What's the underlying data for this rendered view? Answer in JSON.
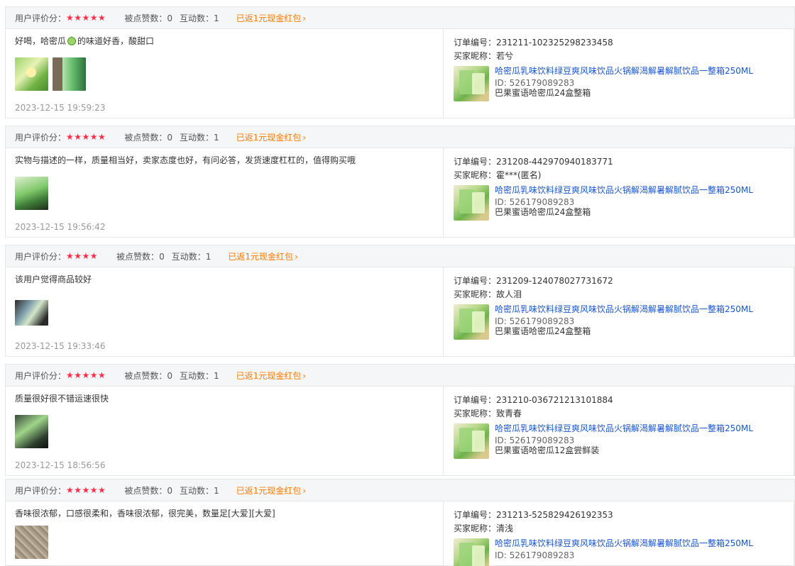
{
  "labels": {
    "rating": "用户评价分：",
    "likes": "被点赞数：",
    "interactions": "互动数：",
    "bonus": "已返1元现金红包",
    "order_no": "订单编号：",
    "buyer": "买家昵称："
  },
  "colors": {
    "star": "#ff2d4a",
    "bonus": "#ff7a00",
    "link": "#1a56c9"
  },
  "icons": {
    "bonus_chevron": "chevron-right-icon",
    "comment_emoji": "melon-emoji-icon"
  },
  "reviews": [
    {
      "stars": "★★★★★",
      "likes": "0",
      "interactions": "1",
      "comment_before": "好喝，哈密瓜",
      "comment_after": "的味道好香，酸甜口",
      "time": "2023-12-15 19:59:23",
      "order": "231211-102325298233458",
      "buyer": "若兮",
      "product_title": "哈密瓜乳味饮料绿豆爽风味饮品火锅解渴解暑解腻饮品一整箱250ML",
      "product_id": "ID: 526179089283",
      "sku": "巴果蜜语哈密瓜24盒整箱"
    },
    {
      "stars": "★★★★★",
      "likes": "0",
      "interactions": "1",
      "comment": "实物与描述的一样，质量相当好，卖家态度也好，有问必答，发货速度杠杠的，值得购买哦",
      "time": "2023-12-15 19:56:42",
      "order": "231208-442970940183771",
      "buyer": "霍***(匿名)",
      "product_title": "哈密瓜乳味饮料绿豆爽风味饮品火锅解渴解暑解腻饮品一整箱250ML",
      "product_id": "ID: 526179089283",
      "sku": "巴果蜜语哈密瓜24盒整箱"
    },
    {
      "stars": "★★★★",
      "likes": "0",
      "interactions": "1",
      "comment": "该用户觉得商品较好",
      "time": "2023-12-15 19:33:46",
      "order": "231209-124078027731672",
      "buyer": "故人泪",
      "product_title": "哈密瓜乳味饮料绿豆爽风味饮品火锅解渴解暑解腻饮品一整箱250ML",
      "product_id": "ID: 526179089283",
      "sku": "巴果蜜语哈密瓜24盒整箱"
    },
    {
      "stars": "★★★★★",
      "likes": "0",
      "interactions": "1",
      "comment": "质量很好很不错运速很快",
      "time": "2023-12-15 18:56:56",
      "order": "231210-036721213101884",
      "buyer": "致青春",
      "product_title": "哈密瓜乳味饮料绿豆爽风味饮品火锅解渴解暑解腻饮品一整箱250ML",
      "product_id": "ID: 526179089283",
      "sku": "巴果蜜语哈密瓜12盒尝鲜装"
    },
    {
      "stars": "★★★★★",
      "likes": "0",
      "interactions": "1",
      "comment": "香味很浓郁，口感很柔和，香味很浓郁，很完美，数量足[大爱][大爱]",
      "order": "231213-525829426192353",
      "buyer": "清浅",
      "product_title": "哈密瓜乳味饮料绿豆爽风味饮品火锅解渴解暑解腻饮品一整箱250ML",
      "product_id": "ID: 526179089283"
    }
  ]
}
